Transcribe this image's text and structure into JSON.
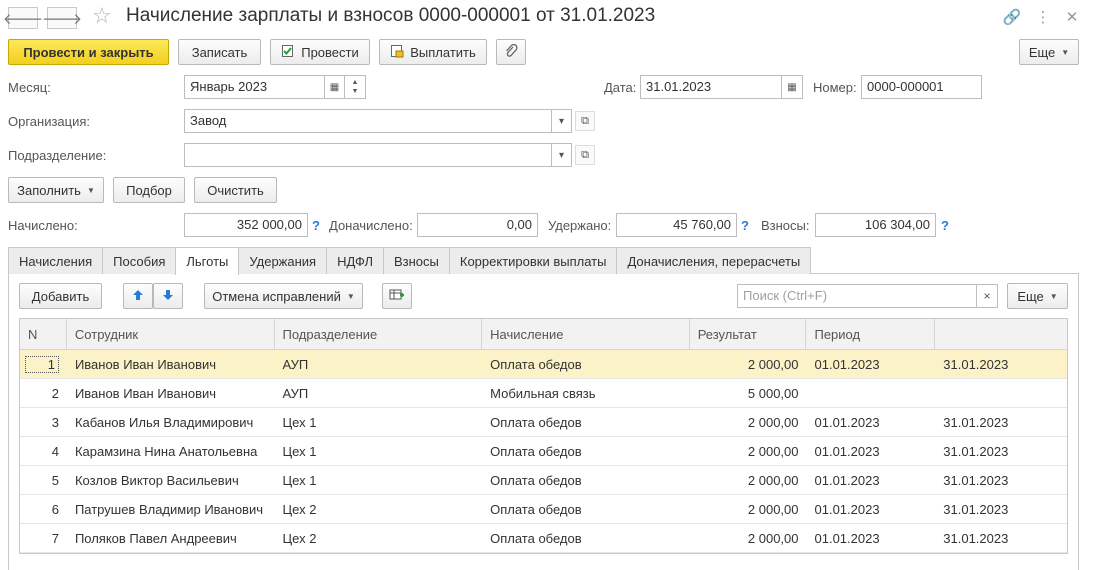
{
  "window": {
    "title": "Начисление зарплаты и взносов 0000-000001 от 31.01.2023"
  },
  "toolbar": {
    "post_and_close": "Провести и закрыть",
    "save": "Записать",
    "post": "Провести",
    "pay": "Выплатить",
    "more": "Еще"
  },
  "header": {
    "month_label": "Месяц:",
    "month_value": "Январь 2023",
    "date_label": "Дата:",
    "date_value": "31.01.2023",
    "number_label": "Номер:",
    "number_value": "0000-000001",
    "org_label": "Организация:",
    "org_value": "Завод",
    "dept_label": "Подразделение:",
    "dept_value": ""
  },
  "actions": {
    "fill": "Заполнить",
    "select": "Подбор",
    "clear": "Очистить"
  },
  "totals": {
    "accrued_label": "Начислено:",
    "accrued_value": "352 000,00",
    "extra_label": "Доначислено:",
    "extra_value": "0,00",
    "withheld_label": "Удержано:",
    "withheld_value": "45 760,00",
    "contrib_label": "Взносы:",
    "contrib_value": "106 304,00",
    "help": "?"
  },
  "tabs": [
    {
      "label": "Начисления"
    },
    {
      "label": "Пособия"
    },
    {
      "label": "Льготы"
    },
    {
      "label": "Удержания"
    },
    {
      "label": "НДФЛ"
    },
    {
      "label": "Взносы"
    },
    {
      "label": "Корректировки выплаты"
    },
    {
      "label": "Доначисления, перерасчеты"
    }
  ],
  "active_tab": "Льготы",
  "panel_toolbar": {
    "add": "Добавить",
    "cancel_corrections": "Отмена исправлений",
    "search_placeholder": "Поиск (Ctrl+F)",
    "more": "Еще"
  },
  "table": {
    "columns": [
      "N",
      "Сотрудник",
      "Подразделение",
      "Начисление",
      "Результат",
      "Период",
      ""
    ],
    "rows": [
      {
        "n": "1",
        "employee": "Иванов Иван Иванович",
        "dept": "АУП",
        "accrual": "Оплата обедов",
        "result": "2 000,00",
        "from": "01.01.2023",
        "to": "31.01.2023"
      },
      {
        "n": "2",
        "employee": "Иванов Иван Иванович",
        "dept": "АУП",
        "accrual": "Мобильная связь",
        "result": "5 000,00",
        "from": "",
        "to": ""
      },
      {
        "n": "3",
        "employee": "Кабанов Илья Владимирович",
        "dept": "Цех 1",
        "accrual": "Оплата обедов",
        "result": "2 000,00",
        "from": "01.01.2023",
        "to": "31.01.2023"
      },
      {
        "n": "4",
        "employee": "Карамзина Нина Анатольевна",
        "dept": "Цех 1",
        "accrual": "Оплата обедов",
        "result": "2 000,00",
        "from": "01.01.2023",
        "to": "31.01.2023"
      },
      {
        "n": "5",
        "employee": "Козлов Виктор Васильевич",
        "dept": "Цех 1",
        "accrual": "Оплата обедов",
        "result": "2 000,00",
        "from": "01.01.2023",
        "to": "31.01.2023"
      },
      {
        "n": "6",
        "employee": "Патрушев Владимир Иванович",
        "dept": "Цех 2",
        "accrual": "Оплата обедов",
        "result": "2 000,00",
        "from": "01.01.2023",
        "to": "31.01.2023"
      },
      {
        "n": "7",
        "employee": "Поляков Павел Андреевич",
        "dept": "Цех 2",
        "accrual": "Оплата обедов",
        "result": "2 000,00",
        "from": "01.01.2023",
        "to": "31.01.2023"
      }
    ],
    "selected_row": 0
  },
  "colors": {
    "primary_button": "#f3cf1e",
    "selected_row": "#fbf2c8",
    "help": "#2a7bd3",
    "arrow_icons": "#2a7bd3"
  }
}
